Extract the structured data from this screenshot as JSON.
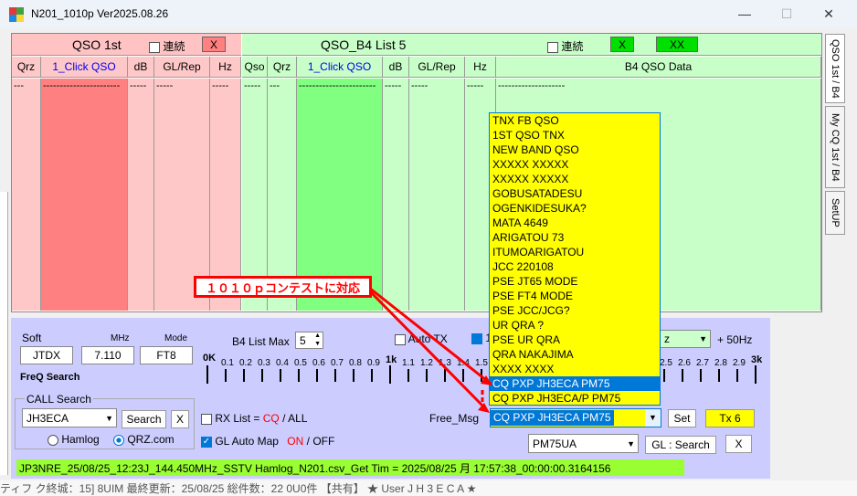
{
  "window": {
    "title": "N201_1010p   Ver2025.08.26",
    "min": "—",
    "max": "☐",
    "close": "✕"
  },
  "tabs": [
    "QSO 1st / B4",
    "My CQ 1st / B4",
    "SetUP"
  ],
  "qso1st": {
    "title": "QSO  1st",
    "renzoku": "連続",
    "x": "X",
    "cols": [
      "Qrz",
      "1_Click QSO",
      "dB",
      "GL/Rep",
      "Hz"
    ],
    "rows": [
      "---",
      "-----------------------",
      "-----",
      "-----",
      "-----"
    ]
  },
  "qsob4": {
    "title": "QSO_B4   List  5",
    "renzoku": "連続",
    "x": "X",
    "xx": "XX",
    "cols": [
      "Qso",
      "Qrz",
      "1_Click QSO",
      "dB",
      "GL/Rep",
      "Hz",
      "B4 QSO Data"
    ],
    "rows": [
      "-----",
      "---",
      "-----------------------",
      "-----",
      "-----",
      "-----",
      "--------------------"
    ]
  },
  "free_msg_list": [
    "TNX FB QSO",
    "1ST QSO TNX",
    "NEW BAND QSO",
    "XXXXX XXXXX",
    "XXXXX XXXXX",
    "GOBUSATADESU",
    "OGENKIDESUKA?",
    "MATA 4649",
    "ARIGATOU 73",
    "ITUMOARIGATOU",
    "JCC 220108",
    "PSE JT65 MODE",
    "PSE FT4 MODE",
    "PSE JCC/JCG?",
    "UR QRA ?",
    "PSE UR QRA",
    "QRA NAKAJIMA",
    "XXXX XXXX",
    "CQ PXP JH3ECA PM75",
    "CQ PXP JH3ECA/P PM75"
  ],
  "free_msg_selected": 18,
  "annotation": "１０１０ｐコンテストに対応",
  "controls": {
    "soft_label": "Soft",
    "soft": "JTDX",
    "mhz_label": "MHz",
    "mhz": "7.110",
    "mode_label": "Mode",
    "mode": "FT8",
    "b4_list_max_label": "B4 List Max",
    "b4_list_max": "5",
    "auto_tx": "Auto TX",
    "hz_suffix": "+ 50Hz",
    "hz_field": "z",
    "freq_search": "FreQ Search",
    "call_search_label": "CALL Search",
    "call": "JH3ECA",
    "search_btn": "Search",
    "x_btn": "X",
    "hamlog": "Hamlog",
    "qrz": "QRZ.com",
    "rx_list": "RX List =",
    "cq": "CQ",
    "slash": "/",
    "all": "ALL",
    "gl_auto_map": "GL Auto Map",
    "on": "ON",
    "off": "OFF",
    "free_msg_label": "Free_Msg",
    "free_msg_value": "CQ PXP JH3ECA PM75",
    "set_btn": "Set",
    "tx_btn": "Tx 6",
    "grid": "PM75UA",
    "gl_search": "GL : Search",
    "x2": "X",
    "scale_left": "0K",
    "scale_mid": "1k",
    "scale_right": "3k",
    "scale_ticks_a": [
      "0.1",
      "0.2",
      "0.3",
      "0.4",
      "0.5",
      "0.6",
      "0.7",
      "0.8",
      "0.9"
    ],
    "scale_ticks_b": [
      "1.1",
      "1.2",
      "1.3",
      "1.4",
      "1.5"
    ],
    "scale_ticks_c": [
      "2.5",
      "2.6",
      "2.7",
      "2.8",
      "2.9"
    ],
    "digit_1": "1"
  },
  "status": "JP3NRE_25/08/25_12:23J_144.450MHz_SSTV              Hamlog_N201.csv_Get Tim = 2025/08/25 月 17:57:38_00:00:00.3164156",
  "background_text": "ティフ ク終城：15] 8UIM     最終更新：25/08/25    総件数：22 0U0件      【共有】                 ★ User    J H 3 E C A  ★"
}
